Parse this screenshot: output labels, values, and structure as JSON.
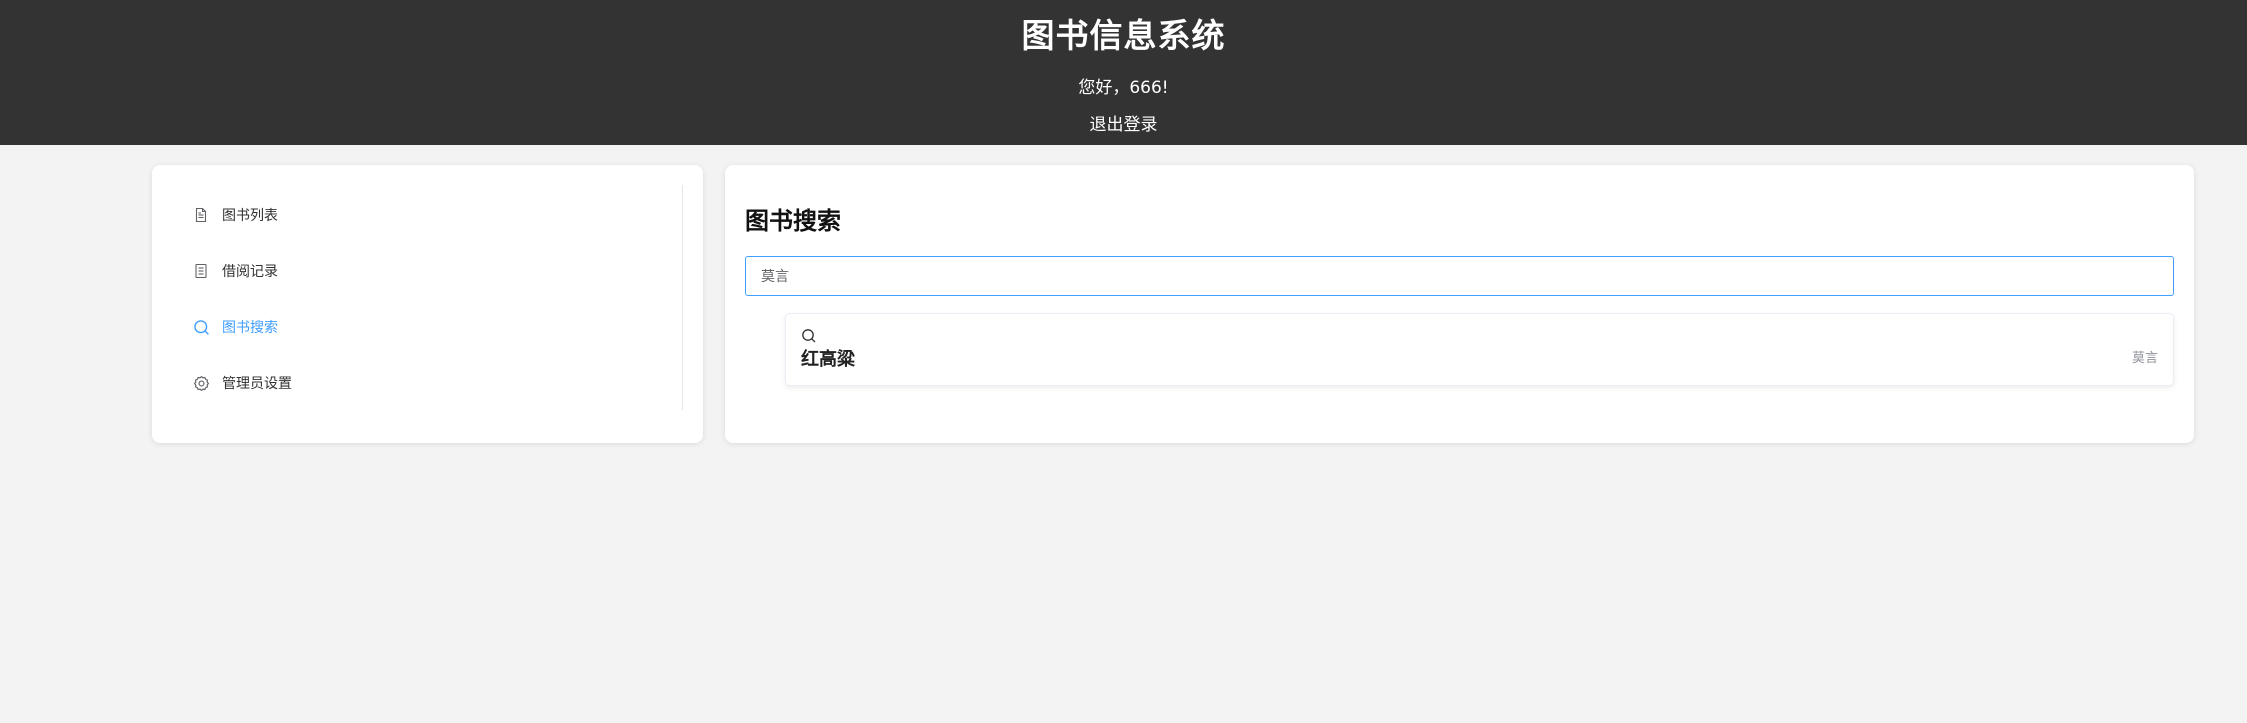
{
  "header": {
    "title": "图书信息系统",
    "greeting": "您好，666!",
    "logout_label": "退出登录"
  },
  "sidebar": {
    "items": [
      {
        "label": "图书列表",
        "icon": "document-icon",
        "active": false
      },
      {
        "label": "借阅记录",
        "icon": "tickets-icon",
        "active": false
      },
      {
        "label": "图书搜索",
        "icon": "search-icon",
        "active": true
      },
      {
        "label": "管理员设置",
        "icon": "setting-icon",
        "active": false
      }
    ]
  },
  "main": {
    "title": "图书搜索",
    "search": {
      "value": "莫言",
      "placeholder": ""
    },
    "results": [
      {
        "title": "红高粱",
        "author": "莫言",
        "icon": "search-icon"
      }
    ]
  },
  "colors": {
    "header_bg": "#333333",
    "page_bg": "#f3f3f3",
    "accent": "#409eff"
  }
}
